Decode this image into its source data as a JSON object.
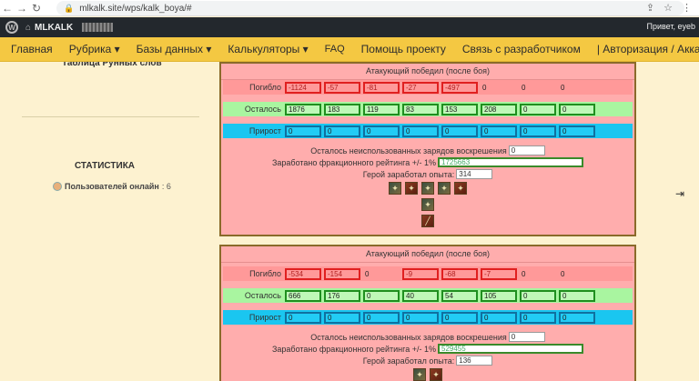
{
  "browser": {
    "url": "mlkalk.site/wps/kalk_boya/#",
    "back": "←",
    "forward": "→",
    "reload": "↻",
    "share": "⇪",
    "star": "☆",
    "menu": "⋮"
  },
  "wpbar": {
    "logo": "W",
    "home_icon": "⌂",
    "site": "MLKALK",
    "greeting": "Привет, eyeb"
  },
  "nav": {
    "items": [
      "Главная",
      "Рубрика ▾",
      "Базы данных ▾",
      "Калькуляторы ▾",
      "FAQ",
      "Помощь проекту",
      "Связь с разработчиком",
      "| Авторизация / Аккаунт | ▾"
    ]
  },
  "sidebar": {
    "cut_heading": "Таблица Рунных слов",
    "stat_title": "СТАТИСТИКА",
    "online_label": "Пользователей онлайн",
    "online_count": ": 6"
  },
  "panels": [
    {
      "title": "Атакующий победил (после боя)",
      "dead_label": "Погибло",
      "dead": [
        "-1124",
        "-57",
        "-81",
        "-27",
        "-497",
        "0",
        "0",
        "0"
      ],
      "left_label": "Осталось",
      "left": [
        "1876",
        "183",
        "119",
        "83",
        "153",
        "208",
        "0",
        "0"
      ],
      "gain_label": "Прирост",
      "gain": [
        "0",
        "0",
        "0",
        "0",
        "0",
        "0",
        "0",
        "0"
      ],
      "charges_label": "Осталось неиспользованных зарядов воскрешения",
      "charges": "0",
      "rating_label": "Заработано фракционного рейтинга +/- 1%",
      "rating": "1725663",
      "exp_label": "Герой заработал опыта:",
      "exp": "314"
    },
    {
      "title": "Атакующий победил (после боя)",
      "dead_label": "Погибло",
      "dead": [
        "-534",
        "-154",
        "0",
        "-9",
        "-68",
        "-7",
        "0",
        "0"
      ],
      "left_label": "Осталось",
      "left": [
        "666",
        "176",
        "0",
        "40",
        "54",
        "105",
        "0",
        "0"
      ],
      "gain_label": "Прирост",
      "gain": [
        "0",
        "0",
        "0",
        "0",
        "0",
        "0",
        "0",
        "0"
      ],
      "charges_label": "Осталось неиспользованных зарядов воскрешения",
      "charges": "0",
      "rating_label": "Заработано фракционного рейтинга +/- 1%",
      "rating": "529455",
      "exp_label": "Герой заработал опыта:",
      "exp": "136"
    }
  ]
}
